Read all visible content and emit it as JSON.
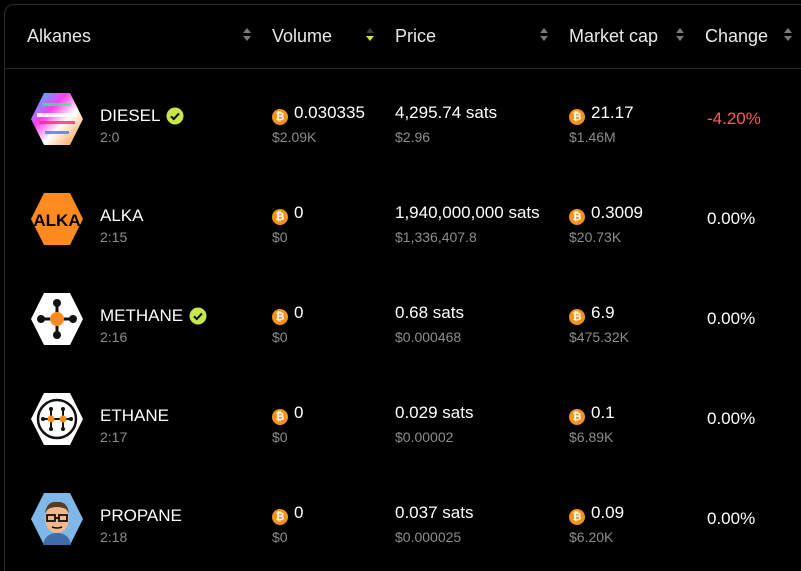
{
  "header": {
    "alkanes": "Alkanes",
    "volume": "Volume",
    "price": "Price",
    "market_cap": "Market cap",
    "change": "Change"
  },
  "colors": {
    "accent": "#c6e84a",
    "negative": "#ff5a5a",
    "btc": "#f7931a"
  },
  "rows": [
    {
      "name": "DIESEL",
      "id": "2:0",
      "verified": true,
      "volume_btc": "0.030335",
      "volume_usd": "$2.09K",
      "price_sats": "4,295.74 sats",
      "price_usd": "$2.96",
      "mcap_btc": "21.17",
      "mcap_usd": "$1.46M",
      "change": "-4.20%",
      "icon": "diesel-logo-icon"
    },
    {
      "name": "ALKA",
      "id": "2:15",
      "verified": false,
      "volume_btc": "0",
      "volume_usd": "$0",
      "price_sats": "1,940,000,000 sats",
      "price_usd": "$1,336,407.8",
      "mcap_btc": "0.3009",
      "mcap_usd": "$20.73K",
      "change": "0.00%",
      "icon": "alka-logo-icon",
      "logo_text": "ALKA"
    },
    {
      "name": "METHANE",
      "id": "2:16",
      "verified": true,
      "volume_btc": "0",
      "volume_usd": "$0",
      "price_sats": "0.68 sats",
      "price_usd": "$0.000468",
      "mcap_btc": "6.9",
      "mcap_usd": "$475.32K",
      "change": "0.00%",
      "icon": "methane-molecule-icon"
    },
    {
      "name": "ETHANE",
      "id": "2:17",
      "verified": false,
      "volume_btc": "0",
      "volume_usd": "$0",
      "price_sats": "0.029 sats",
      "price_usd": "$0.00002",
      "mcap_btc": "0.1",
      "mcap_usd": "$6.89K",
      "change": "0.00%",
      "icon": "ethane-molecule-icon"
    },
    {
      "name": "PROPANE",
      "id": "2:18",
      "verified": false,
      "volume_btc": "0",
      "volume_usd": "$0",
      "price_sats": "0.037 sats",
      "price_usd": "$0.000025",
      "mcap_btc": "0.09",
      "mcap_usd": "$6.20K",
      "change": "0.00%",
      "icon": "propane-avatar-icon"
    }
  ]
}
